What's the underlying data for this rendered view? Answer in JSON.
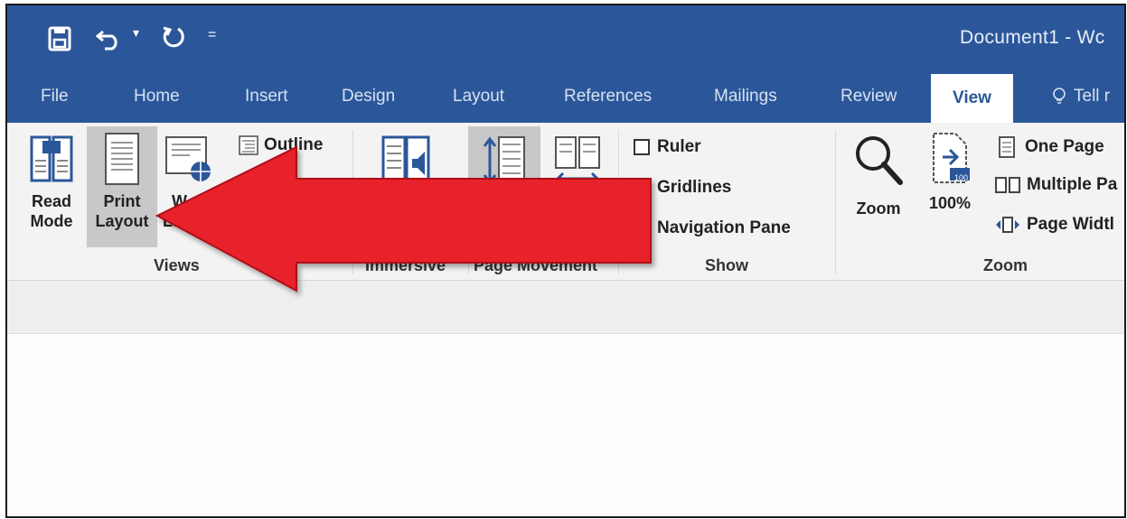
{
  "window": {
    "doc_title": "Document1  -  Wc"
  },
  "quick_access": {
    "save_icon": "save-icon",
    "undo_icon": "undo-icon",
    "redo_icon": "redo-icon",
    "customize_icon": "customize-qat-icon",
    "undo_dropdown": "▾",
    "customize_glyph": "="
  },
  "tabs": [
    {
      "label": "File"
    },
    {
      "label": "Home"
    },
    {
      "label": "Insert"
    },
    {
      "label": "Design"
    },
    {
      "label": "Layout"
    },
    {
      "label": "References"
    },
    {
      "label": "Mailings"
    },
    {
      "label": "Review"
    },
    {
      "label": "View",
      "active": true
    },
    {
      "label": "Tell r"
    }
  ],
  "ribbon": {
    "views": {
      "read_mode": [
        "Read",
        "Mode"
      ],
      "print_layout": [
        "Print",
        "Layout"
      ],
      "web_layout_partial": [
        "W",
        "La"
      ],
      "outline": "Outline",
      "group_label": "Views"
    },
    "immersive": {
      "group_label": "Immersive"
    },
    "page_movement": {
      "group_label": "Page Movement"
    },
    "show": {
      "ruler": "Ruler",
      "gridlines": "Gridlines",
      "navigation_pane": "Navigation Pane",
      "group_label": "Show"
    },
    "zoom": {
      "zoom": "Zoom",
      "hundred": "100%",
      "hundred_badge": "100",
      "one_page": "One Page",
      "multiple_pages": "Multiple Pa",
      "page_width": "Page Widtl",
      "group_label": "Zoom"
    }
  },
  "colors": {
    "title_bar": "#2b579a",
    "ribbon_bg": "#f3f3f3",
    "arrow_red": "#e8202a"
  }
}
